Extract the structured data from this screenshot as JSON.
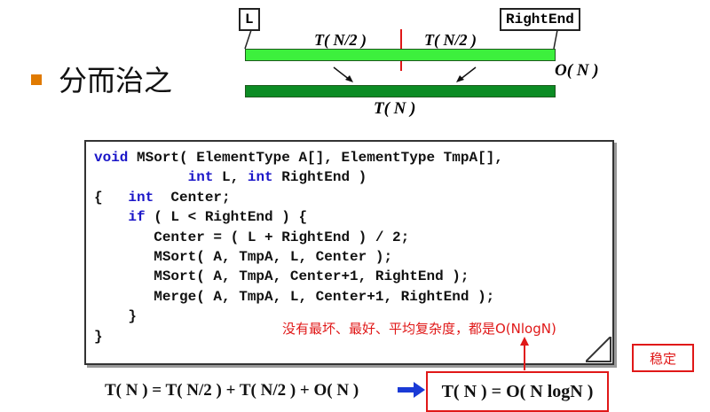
{
  "diagram": {
    "label_left": "L",
    "label_right": "RightEnd",
    "half_left": "T( N/2 )",
    "half_right": "T( N/2 )",
    "merge_cost": "O( N )",
    "total": "T( N )"
  },
  "heading": "分而治之",
  "code_lines": [
    [
      {
        "t": "void",
        "k": true
      },
      {
        "t": " MSort( ElementType A[], ElementType TmpA[],"
      }
    ],
    [
      {
        "t": "           "
      },
      {
        "t": "int",
        "k": true
      },
      {
        "t": " L, "
      },
      {
        "t": "int",
        "k": true
      },
      {
        "t": " RightEnd )"
      }
    ],
    [
      {
        "t": "{   "
      },
      {
        "t": "int",
        "k": true
      },
      {
        "t": "  Center;"
      }
    ],
    [
      {
        "t": "    "
      },
      {
        "t": "if",
        "k": true
      },
      {
        "t": " ( L < RightEnd ) {"
      }
    ],
    [
      {
        "t": "       Center = ( L + RightEnd ) / 2;"
      }
    ],
    [
      {
        "t": "       MSort( A, TmpA, L, Center );"
      }
    ],
    [
      {
        "t": "       MSort( A, TmpA, Center+1, RightEnd );"
      }
    ],
    [
      {
        "t": "       Merge( A, TmpA, L, Center+1, RightEnd );"
      }
    ],
    [
      {
        "t": "    }"
      }
    ],
    [
      {
        "t": "}"
      }
    ]
  ],
  "note": "没有最坏、最好、平均复杂度，都是O(NlogN)",
  "stable_label": "稳定",
  "recurrence": "T( N ) = T( N/2 ) + T( N/2 ) + O( N )",
  "result": "T( N ) = O( N logN )",
  "colors": {
    "keyword": "#1b16c8",
    "accent_red": "#e01818",
    "bar_light": "#3df03d",
    "bar_dark": "#0c8c24",
    "bullet": "#e07a00",
    "arrow_blue": "#1a3ad6"
  }
}
